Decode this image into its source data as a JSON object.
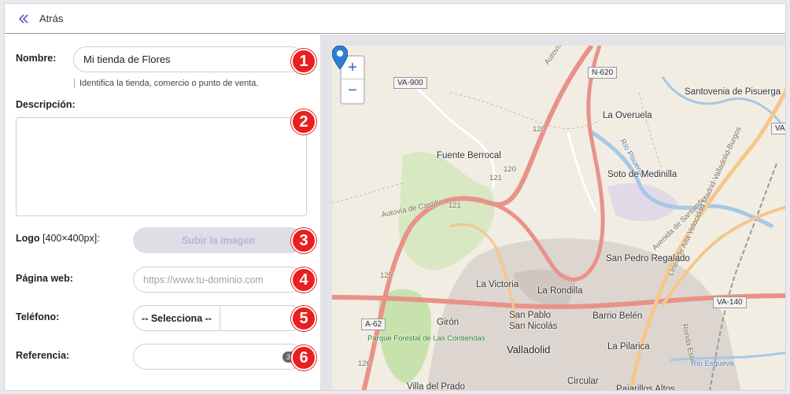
{
  "header": {
    "back_label": "Atrás"
  },
  "form": {
    "name": {
      "label": "Nombre:",
      "value": "Mi tienda de Flores",
      "hint": "Identifica la tienda, comercio o punto de venta."
    },
    "description": {
      "label": "Descripción:"
    },
    "logo": {
      "label": "Logo",
      "size_note": "[400×400px]:",
      "button": "Subir la imagen"
    },
    "website": {
      "label": "Página web:",
      "placeholder": "https://www.tu-dominio.com"
    },
    "phone": {
      "label": "Teléfono:",
      "select": "-- Selecciona --"
    },
    "reference": {
      "label": "Referencia:",
      "counter": "30"
    }
  },
  "badges": [
    "1",
    "2",
    "3",
    "4",
    "5",
    "6"
  ],
  "map": {
    "zoom_in": "+",
    "zoom_out": "−",
    "road_labels": [
      "VA-900",
      "N-620",
      "VA-140",
      "A-62",
      "VA-"
    ],
    "road_ref_labels": [
      "120",
      "120",
      "121",
      "121",
      "125",
      "126"
    ],
    "road_names": [
      "Autovía de Castilla",
      "Autovía de Castilla",
      "Avenida de Santander",
      "Línea de Alta Velocidad Madrid-Valladolid-Burgos",
      "Ronda Este",
      "Río Pisuerga",
      "Río Esgueva"
    ],
    "places": [
      "Santovenia de Pisuerga",
      "La Overuela",
      "Fuente Berrocal",
      "Soto de Medinilla",
      "San Pedro Regalado",
      "La Victoria",
      "La Rondilla",
      "San Pablo",
      "San Nicolás",
      "Barrio Belén",
      "Girón",
      "Valladolid",
      "La Pilarica",
      "Circular",
      "Villa del Prado",
      "Pajarillos Altos"
    ],
    "park": "Parque Forestal de Las Contiendas",
    "colors": {
      "motorway": "#e8928a",
      "primary": "#f6c68a",
      "urban": "#d9d0c9",
      "park": "#c8e2ad",
      "water": "#a6c8e6",
      "pin": "#2a7fd4"
    }
  }
}
